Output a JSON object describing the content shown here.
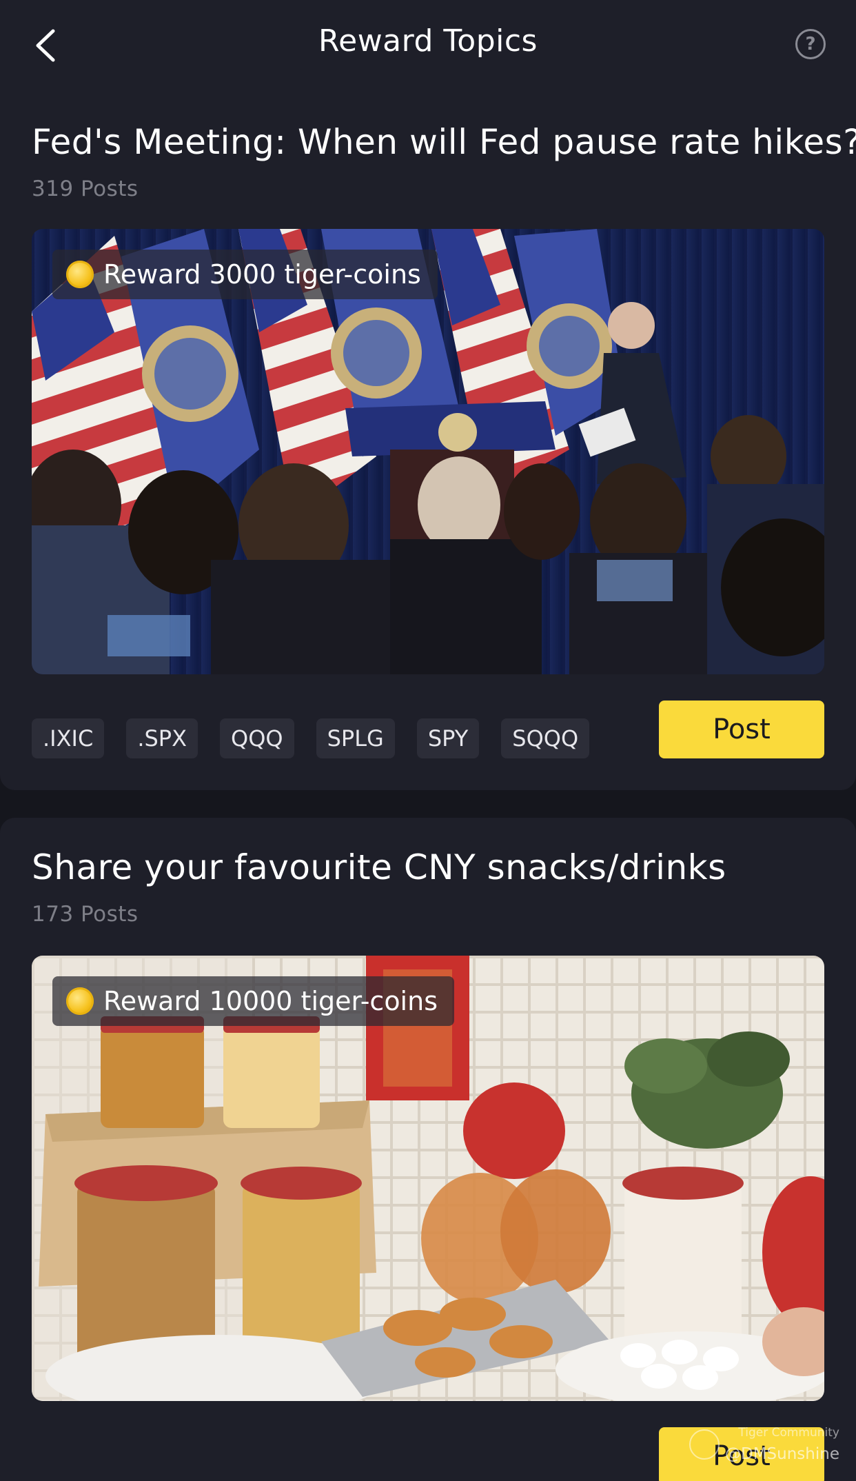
{
  "header": {
    "title": "Reward Topics",
    "help_label": "?"
  },
  "topics": [
    {
      "title": "Fed's Meeting: When will Fed pause rate hikes?",
      "posts": "319 Posts",
      "reward": "Reward 3000 tiger-coins",
      "tickers": [
        ".IXIC",
        ".SPX",
        "QQQ",
        "SPLG",
        "SPY",
        "SQQQ"
      ],
      "post_label": "Post"
    },
    {
      "title": "Share your favourite CNY snacks/drinks",
      "posts": "173 Posts",
      "reward": "Reward 10000 tiger-coins",
      "post_label": "Post"
    }
  ],
  "watermark": {
    "brand": "Tiger Community",
    "user": "@DMSunshine"
  },
  "colors": {
    "background": "#15161d",
    "card": "#1e1f29",
    "accent": "#fada3b",
    "muted_text": "#7e7f88",
    "coin": "#f6c21e"
  }
}
